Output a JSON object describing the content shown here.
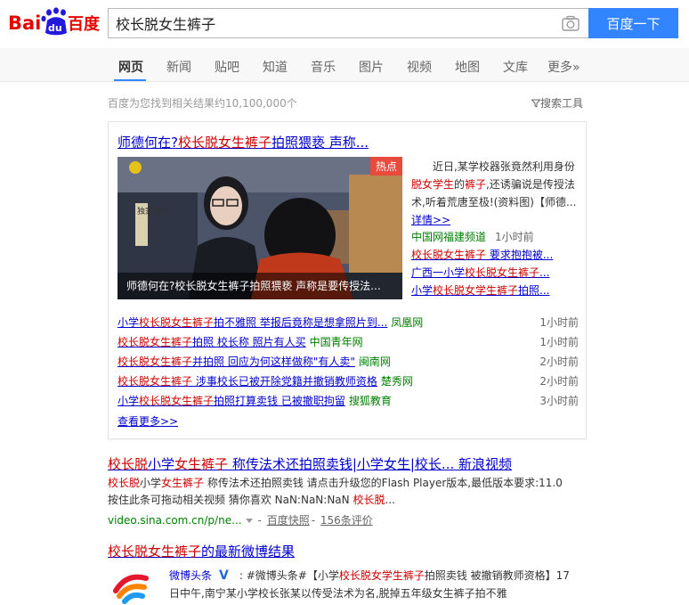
{
  "header": {
    "logo_text_left": "Bai",
    "logo_text_paw": "du",
    "logo_text_right": "百度",
    "search_value": "校长脱女生裤子",
    "search_button": "百度一下"
  },
  "tabs": [
    {
      "label": "网页",
      "active": true
    },
    {
      "label": "新闻"
    },
    {
      "label": "贴吧"
    },
    {
      "label": "知道"
    },
    {
      "label": "音乐"
    },
    {
      "label": "图片"
    },
    {
      "label": "视频"
    },
    {
      "label": "地图"
    },
    {
      "label": "文库"
    },
    {
      "label": "更多»"
    }
  ],
  "result_count": "百度为您找到相关结果约10,100,000个",
  "search_tools": "搜索工具",
  "news_card": {
    "title_prefix": "师德何在?",
    "title_hl": "校长脱女生裤子",
    "title_suffix": "拍照猥亵 声称...",
    "hot_badge": "热点",
    "video_caption": "师德何在?校长脱女生裤子拍照猥亵 声称是要传授法...",
    "video_overlay_labels": [
      "独家报道"
    ],
    "summary": {
      "t1": "近日,某学校器张竟然利用身份",
      "h1": "脱女学生",
      "t2": "的",
      "h2": "裤子",
      "t3": ",还诱骗说是传授法术,听着荒唐至极!(资料图)【师德...",
      "read_more": "详情>>"
    },
    "source": "中国网福建频道",
    "source_time": "1小时前",
    "side_links": [
      {
        "pre": "",
        "hl": "校长脱女生裤子",
        "post": " 要求抱抱被..."
      },
      {
        "pre": "广西一小学",
        "hl": "校长脱女生裤子",
        "post": "..."
      },
      {
        "pre": "小学",
        "hl": "校长脱女学生裤子",
        "post": "拍照..."
      }
    ],
    "rows": [
      {
        "pre": "小学",
        "hl": "校长脱女生裤子",
        "post": "拍不雅照 举报后竟称是想拿照片到...",
        "source": "凤凰网",
        "time": "1小时前"
      },
      {
        "pre": "",
        "hl": "校长脱女生裤子",
        "post": "拍照 校长称 照片有人买",
        "source": "中国青年网",
        "time": "1小时前"
      },
      {
        "pre": "",
        "hl": "校长脱女生裤子",
        "post": "并拍照 回应为何这样做称\"有人卖\"",
        "source": "闽南网",
        "time": "2小时前"
      },
      {
        "pre": "",
        "hl": "校长脱女生裤子",
        "post": " 涉事校长已被开除党籍并撤销教师资格",
        "source": "楚秀网",
        "time": "2小时前"
      },
      {
        "pre": "小学",
        "hl": "校长脱女生裤子",
        "post": "拍照打算卖钱 已被撤职拘留",
        "source": "搜狐教育",
        "time": "3小时前"
      }
    ],
    "view_more": "查看更多>>"
  },
  "result2": {
    "title_hl1": "校长脱",
    "title_t1": "小学",
    "title_hl2": "女生裤子",
    "title_t2": " 称传法术还拍照卖钱|小学女生|校长... 新浪视频",
    "abs_hl1": "校长脱",
    "abs_t1": "小学",
    "abs_hl2": "女生裤子",
    "abs_t2": " 称传法术还拍照卖钱 请点击升级您的Flash Player版本,最低版本要求:11.0 按住此条可拖动相关视频 猜你喜欢 NaN:NaN:NaN ",
    "abs_hl3": "校长脱",
    "abs_t3": "...",
    "url": "video.sina.com.cn/p/ne...",
    "sep": "-",
    "snapshot": "百度快照",
    "comments": "156条评价"
  },
  "result3": {
    "title_hl": "校长脱女生裤子",
    "title_t": "的最新微博结果",
    "author": "微博头条",
    "vbadge": "V",
    "t1": ": #微博头条#【小学",
    "hl1": "校长脱女学生裤子",
    "t2": "拍照卖钱 被撤销教师资格】17日中午,南宁某小学校长张某以传受法术为名,脱掉五年级女生裤子拍不雅"
  },
  "colors": {
    "brand_red": "#e10602",
    "brand_blue": "#2319dc",
    "link_blue": "#0000cc",
    "highlight_red": "#cc0000",
    "source_green": "#008000",
    "button_blue": "#3385ff",
    "hot_red": "#e84b3c"
  }
}
